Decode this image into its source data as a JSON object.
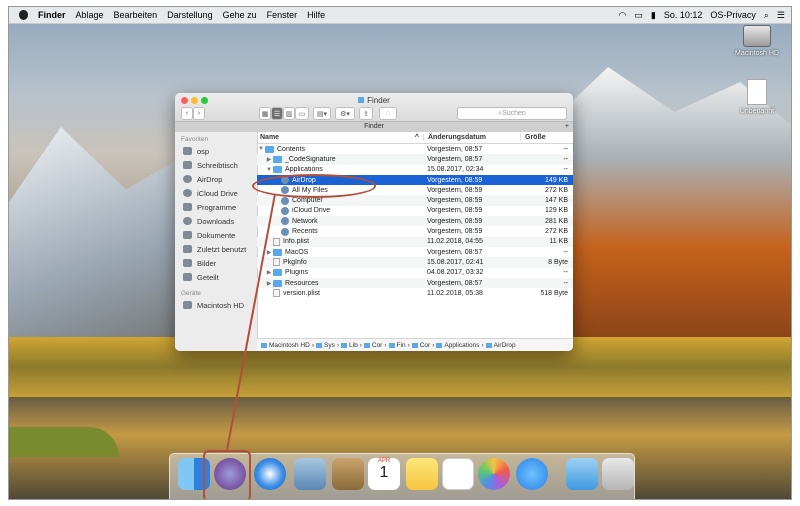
{
  "menubar": {
    "app": "Finder",
    "items": [
      "Ablage",
      "Bearbeiten",
      "Darstellung",
      "Gehe zu",
      "Fenster",
      "Hilfe"
    ],
    "time": "So. 10:12",
    "user": "OS-Privacy"
  },
  "desktop": {
    "icons": [
      "Macintosh HD",
      "Unbenannt"
    ]
  },
  "window": {
    "title": "Finder",
    "tab": "Finder",
    "search_placeholder": "Suchen"
  },
  "sidebar": {
    "favorites_label": "Favoriten",
    "favorites": [
      "osp",
      "Schreibtisch",
      "AirDrop",
      "iCloud Drive",
      "Programme",
      "Downloads",
      "Dokumente",
      "Zuletzt benutzt",
      "Bilder",
      "Geteilt"
    ],
    "devices_label": "Geräte",
    "devices": [
      "Macintosh HD"
    ]
  },
  "columns": {
    "name": "Name",
    "date": "Änderungsdatum",
    "size": "Größe"
  },
  "rows": [
    {
      "name": "Contents",
      "date": "Vorgestern, 08:57",
      "size": "--"
    },
    {
      "name": "_CodeSignature",
      "date": "Vorgestern, 08:57",
      "size": "--"
    },
    {
      "name": "Applications",
      "date": "15.08.2017, 02:34",
      "size": "--"
    },
    {
      "name": "AirDrop",
      "date": "Vorgestern, 08:59",
      "size": "149 KB"
    },
    {
      "name": "All My Files",
      "date": "Vorgestern, 08:59",
      "size": "272 KB"
    },
    {
      "name": "Computer",
      "date": "Vorgestern, 08:59",
      "size": "147 KB"
    },
    {
      "name": "iCloud Drive",
      "date": "Vorgestern, 08:59",
      "size": "129 KB"
    },
    {
      "name": "Network",
      "date": "Vorgestern, 08:59",
      "size": "281 KB"
    },
    {
      "name": "Recents",
      "date": "Vorgestern, 08:59",
      "size": "272 KB"
    },
    {
      "name": "Info.plist",
      "date": "11.02.2018, 04:55",
      "size": "11 KB"
    },
    {
      "name": "MacOS",
      "date": "Vorgestern, 08:57",
      "size": "--"
    },
    {
      "name": "PkgInfo",
      "date": "15.08.2017, 02:41",
      "size": "8 Byte"
    },
    {
      "name": "Plugins",
      "date": "04.08.2017, 03:32",
      "size": "--"
    },
    {
      "name": "Resources",
      "date": "Vorgestern, 08:57",
      "size": "--"
    },
    {
      "name": "version.plist",
      "date": "11.02.2018, 05:38",
      "size": "518 Byte"
    }
  ],
  "pathbar": [
    "Macintosh HD",
    "Sys",
    "Lib",
    "Cor",
    "Fin",
    "Cor",
    "Applications",
    "AirDrop"
  ],
  "dock_calendar": {
    "month": "APR",
    "day": "1"
  },
  "colors": {
    "selection": "#1b63d4",
    "annotation": "#b0503c",
    "folder": "#5ba8e8"
  }
}
